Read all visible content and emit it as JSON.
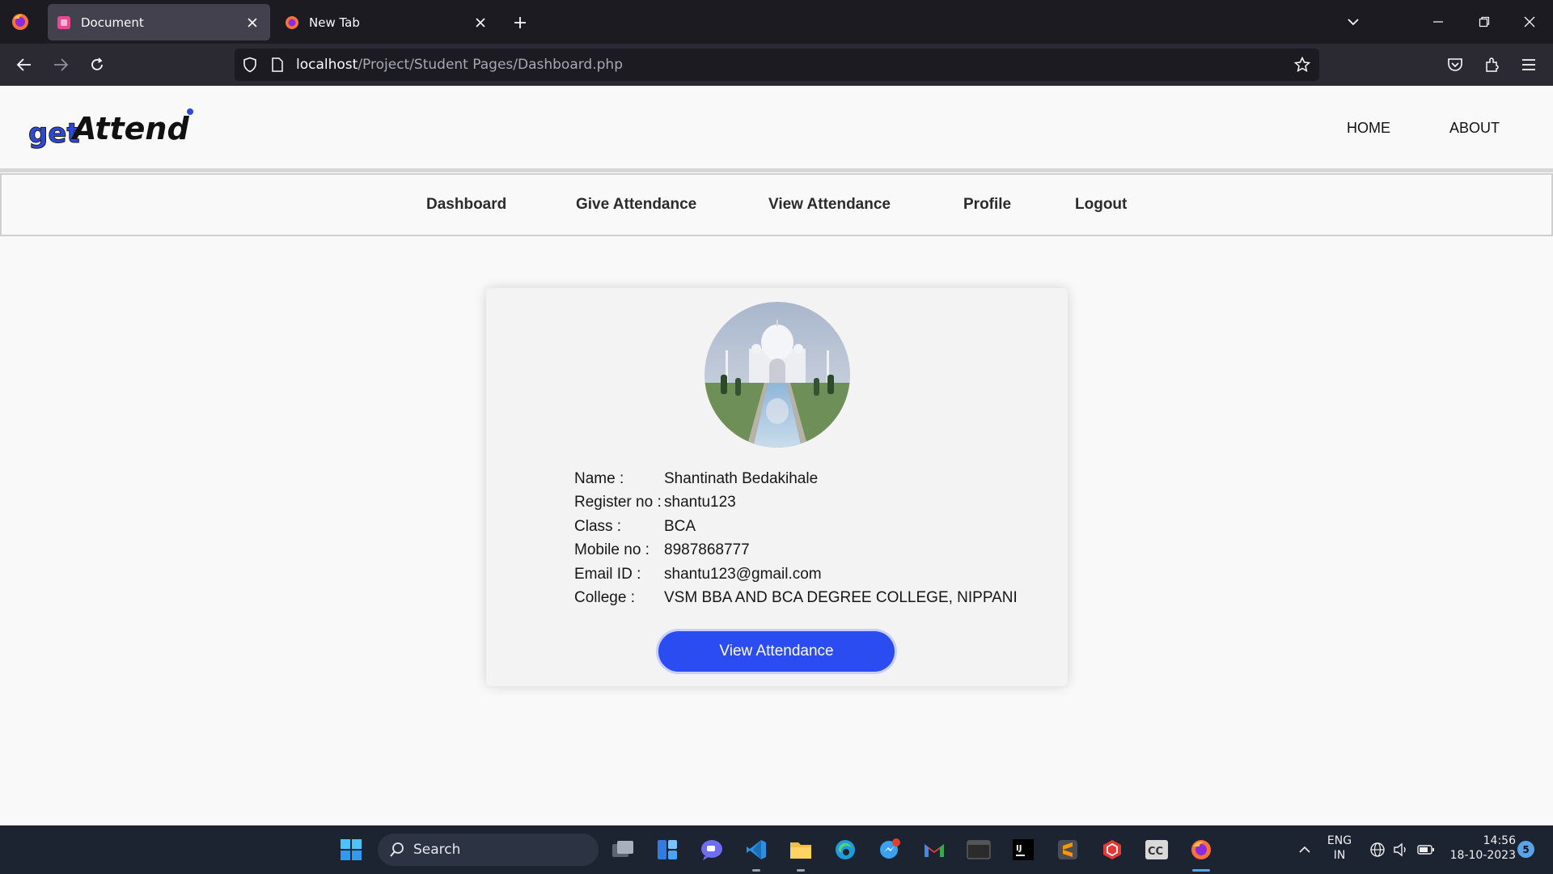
{
  "browser": {
    "tabs": [
      {
        "title": "Document",
        "active": true
      },
      {
        "title": "New Tab",
        "active": false
      }
    ],
    "url": {
      "host": "localhost",
      "path": "/Project/Student Pages/Dashboard.php"
    }
  },
  "site": {
    "logo": {
      "part1": "get",
      "part2": "Attend"
    },
    "top_nav": [
      "HOME",
      "ABOUT"
    ],
    "menu": [
      "Dashboard",
      "Give Attendance",
      "View Attendance",
      "Profile",
      "Logout"
    ]
  },
  "profile": {
    "fields": [
      {
        "label": "Name :",
        "value": "Shantinath Bedakihale"
      },
      {
        "label": "Register no :",
        "value": "shantu123"
      },
      {
        "label": "Class :",
        "value": "BCA"
      },
      {
        "label": "Mobile no :",
        "value": "8987868777"
      },
      {
        "label": "Email ID :",
        "value": "shantu123@gmail.com"
      },
      {
        "label": "College :",
        "value": "VSM BBA AND BCA DEGREE COLLEGE, NIPPANI"
      }
    ],
    "button_label": "View Attendance"
  },
  "taskbar": {
    "search_label": "Search",
    "language": {
      "line1": "ENG",
      "line2": "IN"
    },
    "time": "14:56",
    "date": "18-10-2023",
    "notification_count": "5"
  },
  "colors": {
    "accent": "#2a4cf0",
    "logo_blue": "#2e48d8"
  }
}
